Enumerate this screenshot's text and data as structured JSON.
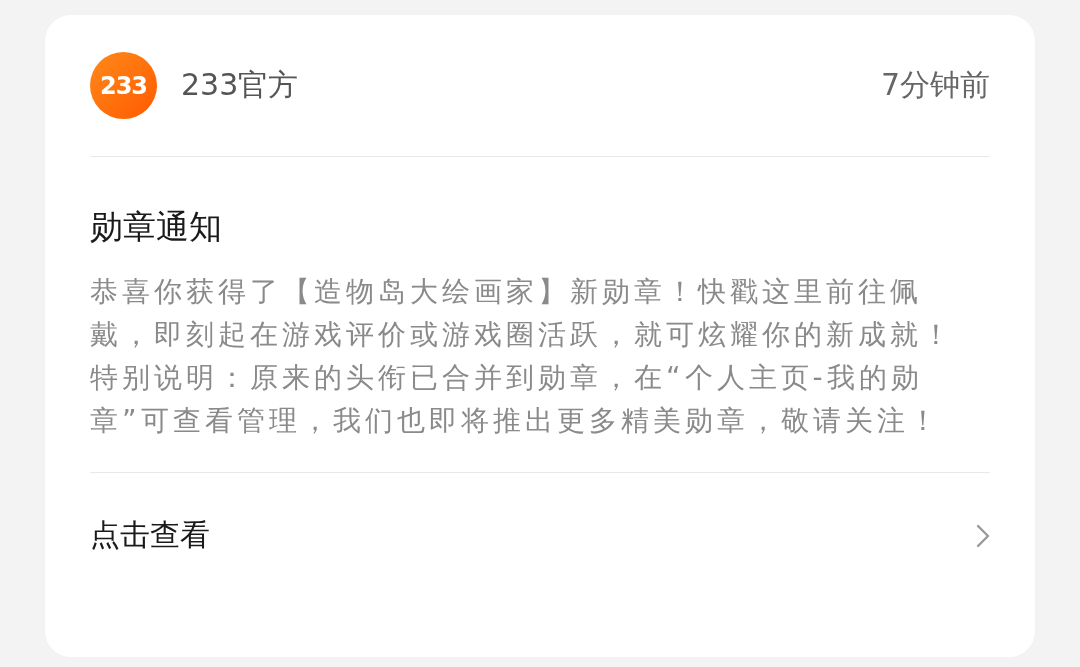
{
  "sender": {
    "logo_text": "233",
    "name": "233官方",
    "time": "7分钟前"
  },
  "notice": {
    "title": "勋章通知",
    "paragraphs": [
      "恭喜你获得了【造物岛大绘画家】新勋章！快戳这里前往佩戴，即刻起在游戏评价或游戏圈活跃，就可炫耀你的新成就！",
      "特别说明：原来的头衔已合并到勋章，在“个人主页-我的勋章”可查看管理，我们也即将推出更多精美勋章，敬请关注！"
    ]
  },
  "action": {
    "label": "点击查看"
  }
}
